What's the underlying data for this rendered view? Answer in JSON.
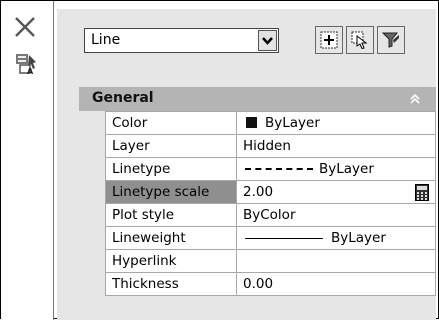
{
  "toolbar": {
    "object_type": "Line"
  },
  "section": {
    "title": "General"
  },
  "properties": [
    {
      "name": "Color",
      "value": "ByLayer"
    },
    {
      "name": "Layer",
      "value": "Hidden"
    },
    {
      "name": "Linetype",
      "value": "ByLayer"
    },
    {
      "name": "Linetype scale",
      "value": "2.00"
    },
    {
      "name": "Plot style",
      "value": "ByColor"
    },
    {
      "name": "Lineweight",
      "value": "ByLayer"
    },
    {
      "name": "Hyperlink",
      "value": ""
    },
    {
      "name": "Thickness",
      "value": "0.00"
    }
  ],
  "colors": {
    "selected_row": "#8f8f8f",
    "header": "#b4b4b4",
    "panel": "#e6e6e6"
  },
  "icons": [
    "close-icon",
    "properties-icon",
    "quick-select-icon",
    "select-objects-icon",
    "pickadd-toggle-icon",
    "collapse-icon",
    "calculator-icon",
    "dropdown-arrow-icon"
  ]
}
